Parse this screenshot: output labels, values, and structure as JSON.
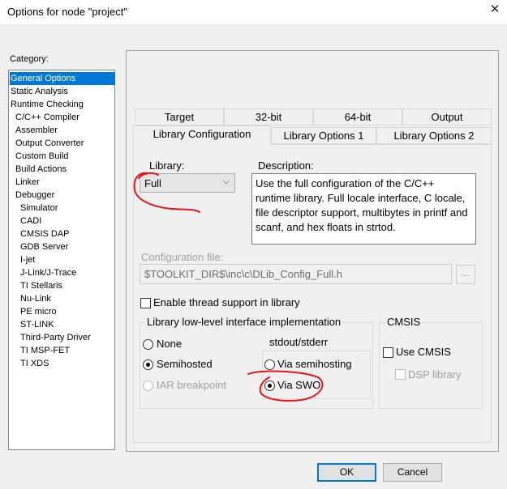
{
  "window": {
    "title": "Options for node \"project\"",
    "close_glyph": "✕"
  },
  "category": {
    "label": "Category:",
    "items": [
      {
        "label": "General Options",
        "selected": true
      },
      {
        "label": "Static Analysis"
      },
      {
        "label": "Runtime Checking"
      },
      {
        "label": "C/C++ Compiler"
      },
      {
        "label": "Assembler"
      },
      {
        "label": "Output Converter"
      },
      {
        "label": "Custom Build"
      },
      {
        "label": "Build Actions"
      },
      {
        "label": "Linker"
      },
      {
        "label": "Debugger"
      },
      {
        "label": "Simulator"
      },
      {
        "label": "CADI"
      },
      {
        "label": "CMSIS DAP"
      },
      {
        "label": "GDB Server"
      },
      {
        "label": "I-jet"
      },
      {
        "label": "J-Link/J-Trace"
      },
      {
        "label": "TI Stellaris"
      },
      {
        "label": "Nu-Link"
      },
      {
        "label": "PE micro"
      },
      {
        "label": "ST-LINK"
      },
      {
        "label": "Third-Party Driver"
      },
      {
        "label": "TI MSP-FET"
      },
      {
        "label": "TI XDS"
      }
    ]
  },
  "tabs": {
    "row1": [
      "Target",
      "32-bit",
      "64-bit",
      "Output"
    ],
    "row2": [
      "Library Configuration",
      "Library Options 1",
      "Library Options 2"
    ],
    "active": "Library Configuration"
  },
  "library": {
    "label": "Library:",
    "value": "Full",
    "arrow": "⌵"
  },
  "description": {
    "label": "Description:",
    "text": "Use the full configuration of the C/C++ runtime library. Full locale interface, C locale, file descriptor support, multibytes in printf and scanf, and hex floats in strtod."
  },
  "config_file": {
    "label": "Configuration file:",
    "value": "$TOOLKIT_DIR$\\inc\\c\\DLib_Config_Full.h",
    "browse": "..."
  },
  "thread_support": {
    "label": "Enable thread support in library",
    "checked": false
  },
  "lowlevel": {
    "title": "Library low-level interface implementation",
    "options": [
      {
        "label": "None",
        "checked": false,
        "enabled": true
      },
      {
        "label": "Semihosted",
        "checked": true,
        "enabled": true
      },
      {
        "label": "IAR breakpoint",
        "checked": false,
        "enabled": false
      }
    ],
    "stdout": {
      "title": "stdout/stderr",
      "options": [
        {
          "label": "Via semihosting",
          "checked": false
        },
        {
          "label": "Via SWO",
          "checked": true
        }
      ]
    }
  },
  "cmsis": {
    "title": "CMSIS",
    "use_cmsis": {
      "label": "Use CMSIS",
      "checked": false
    },
    "dsp": {
      "label": "DSP library",
      "checked": false,
      "enabled": false
    }
  },
  "buttons": {
    "ok": "OK",
    "cancel": "Cancel"
  },
  "colors": {
    "selection": "#0078d7",
    "annotation": "#e8141c"
  }
}
